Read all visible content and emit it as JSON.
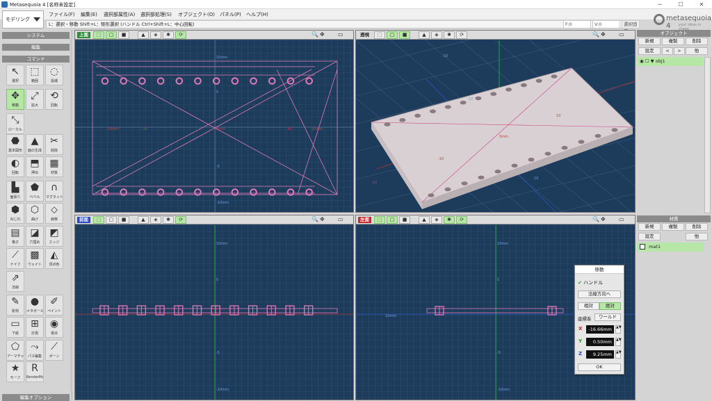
{
  "window": {
    "title": "Metasequoia 4 [名称未設定]",
    "minimize": "─",
    "maximize": "☐",
    "close": "✕"
  },
  "mode": {
    "selected": "モデリング"
  },
  "menu": [
    "ファイル(F)",
    "編集(E)",
    "選択部属性(A)",
    "選択部処理(S)",
    "オブジェクト(O)",
    "パネル(P)",
    "ヘルプ(H)"
  ],
  "status": {
    "hint": "L：選択・移動 Shift+L：矩形選択 (ハンドル Ctrl+Shift+L：中心回転)",
    "faces": "F:0",
    "vertices": "V:0",
    "selected_label": "選択固定"
  },
  "logo": {
    "text": "metasequoia 4",
    "sub": "your ideas in shape"
  },
  "left": {
    "system": "システム",
    "edit": "編集",
    "command": "コマンド",
    "edit_options": "編集オプション",
    "tools": [
      {
        "label": "選択",
        "icon": "↖",
        "name": "select-tool"
      },
      {
        "label": "範囲",
        "icon": "⬚",
        "name": "range-tool"
      },
      {
        "label": "投縄",
        "icon": "◌",
        "name": "lasso-tool"
      },
      {
        "label": "移動",
        "icon": "✥",
        "name": "move-tool",
        "selected": true
      },
      {
        "label": "拡大",
        "icon": "⤢",
        "name": "scale-tool"
      },
      {
        "label": "回転",
        "icon": "⟲",
        "name": "rotate-tool"
      },
      {
        "label": "ローカル",
        "icon": "⤡",
        "name": "local-tool"
      },
      {
        "label": "基本図形",
        "icon": "⬣",
        "name": "primitive-tool"
      },
      {
        "label": "面の生成",
        "icon": "▲",
        "name": "create-face-tool"
      },
      {
        "label": "削除",
        "icon": "✂",
        "name": "delete-tool"
      },
      {
        "label": "回転",
        "icon": "◐",
        "name": "lathe-tool"
      },
      {
        "label": "押出",
        "icon": "⬒",
        "name": "extrude-tool"
      },
      {
        "label": "材質",
        "icon": "▦",
        "name": "material-tool"
      },
      {
        "label": "面張り",
        "icon": "▙",
        "name": "face-fill-tool"
      },
      {
        "label": "ベベル",
        "icon": "⬟",
        "name": "bevel-tool"
      },
      {
        "label": "マグネット",
        "icon": "∩",
        "name": "magnet-tool"
      },
      {
        "label": "ねじれ",
        "icon": "⬢",
        "name": "twist-tool"
      },
      {
        "label": "曲げ",
        "icon": "⬡",
        "name": "bend-tool"
      },
      {
        "label": "線移",
        "icon": "⬦",
        "name": "line-move-tool"
      },
      {
        "label": "格子",
        "icon": "▤",
        "name": "lattice-tool"
      },
      {
        "label": "穴埋め",
        "icon": "◪",
        "name": "fill-hole-tool"
      },
      {
        "label": "エッジ",
        "icon": "◩",
        "name": "edge-tool"
      },
      {
        "label": "ナイフ",
        "icon": "⟋",
        "name": "knife-tool"
      },
      {
        "label": "ウェイト",
        "icon": "▩",
        "name": "weight-tool"
      },
      {
        "label": "頂点色",
        "icon": "◭",
        "name": "vertex-color-tool"
      },
      {
        "label": "法線",
        "icon": "⇗",
        "name": "normal-tool"
      },
      {
        "label": "彫刻",
        "icon": "✎",
        "name": "sculpt-tool"
      },
      {
        "label": "メタボール",
        "icon": "●",
        "name": "metaball-tool"
      },
      {
        "label": "ペイント",
        "icon": "✐",
        "name": "paint-tool"
      },
      {
        "label": "下絵",
        "icon": "▭",
        "name": "background-image-tool"
      },
      {
        "label": "計測",
        "icon": "⊞",
        "name": "measure-tool"
      },
      {
        "label": "視点",
        "icon": "◉",
        "name": "viewpoint-tool"
      },
      {
        "label": "アーマチャー",
        "icon": "⬠",
        "name": "armature-tool"
      },
      {
        "label": "パス編集",
        "icon": "⤳",
        "name": "path-edit-tool"
      },
      {
        "label": "ボーン",
        "icon": "⟋",
        "name": "bone-tool"
      },
      {
        "label": "モーフ",
        "icon": "★",
        "name": "morph-tool"
      },
      {
        "label": "RenderMan",
        "icon": "R",
        "name": "renderman-tool"
      }
    ]
  },
  "viewports": {
    "top": {
      "name": "上面",
      "color": "#2e8b3a"
    },
    "persp": {
      "name": "透視",
      "color": "#444444"
    },
    "front": {
      "name": "前面",
      "color": "#2848c8"
    },
    "side": {
      "name": "左面",
      "color": "#c82828"
    }
  },
  "top_labels": {
    "top": "10mm",
    "bottom": "-10mm",
    "left": "-20mm",
    "mid": "0mm",
    "right": "20mm",
    "n10": "-10",
    "p10": "10",
    "m5": "5",
    "m_5": "-5"
  },
  "persp_labels": {
    "a": "-10",
    "b": "10",
    "c": "0mm",
    "d": "-10",
    "e": "10",
    "f": "-10",
    "g": "10"
  },
  "front_labels": {
    "top": "10mm",
    "bottom": "-10mm",
    "m5": "5",
    "m_5": "-5"
  },
  "side_labels": {
    "top": "10mm",
    "bottom": "-10mm",
    "left": "10mm",
    "m5": "5",
    "m_5": "-5"
  },
  "objects": {
    "title": "オブジェクト",
    "new": "新規",
    "copy": "複製",
    "delete": "削除",
    "settings": "設定",
    "up": "<",
    "down": ">",
    "more": "他",
    "item": "obj1"
  },
  "materials": {
    "title": "材質",
    "new": "新規",
    "copy": "複製",
    "delete": "削除",
    "settings": "設定",
    "more": "他",
    "item": "mat1"
  },
  "move_dialog": {
    "title": "移動",
    "handle": "ハンドル",
    "normal": "法線方向へ",
    "relative": "相対",
    "absolute": "絶対",
    "coord": "座標系",
    "world": "ワールド",
    "x": "-16.66mm",
    "y": "0.50mm",
    "z": "9.25mm",
    "ok": "OK"
  }
}
